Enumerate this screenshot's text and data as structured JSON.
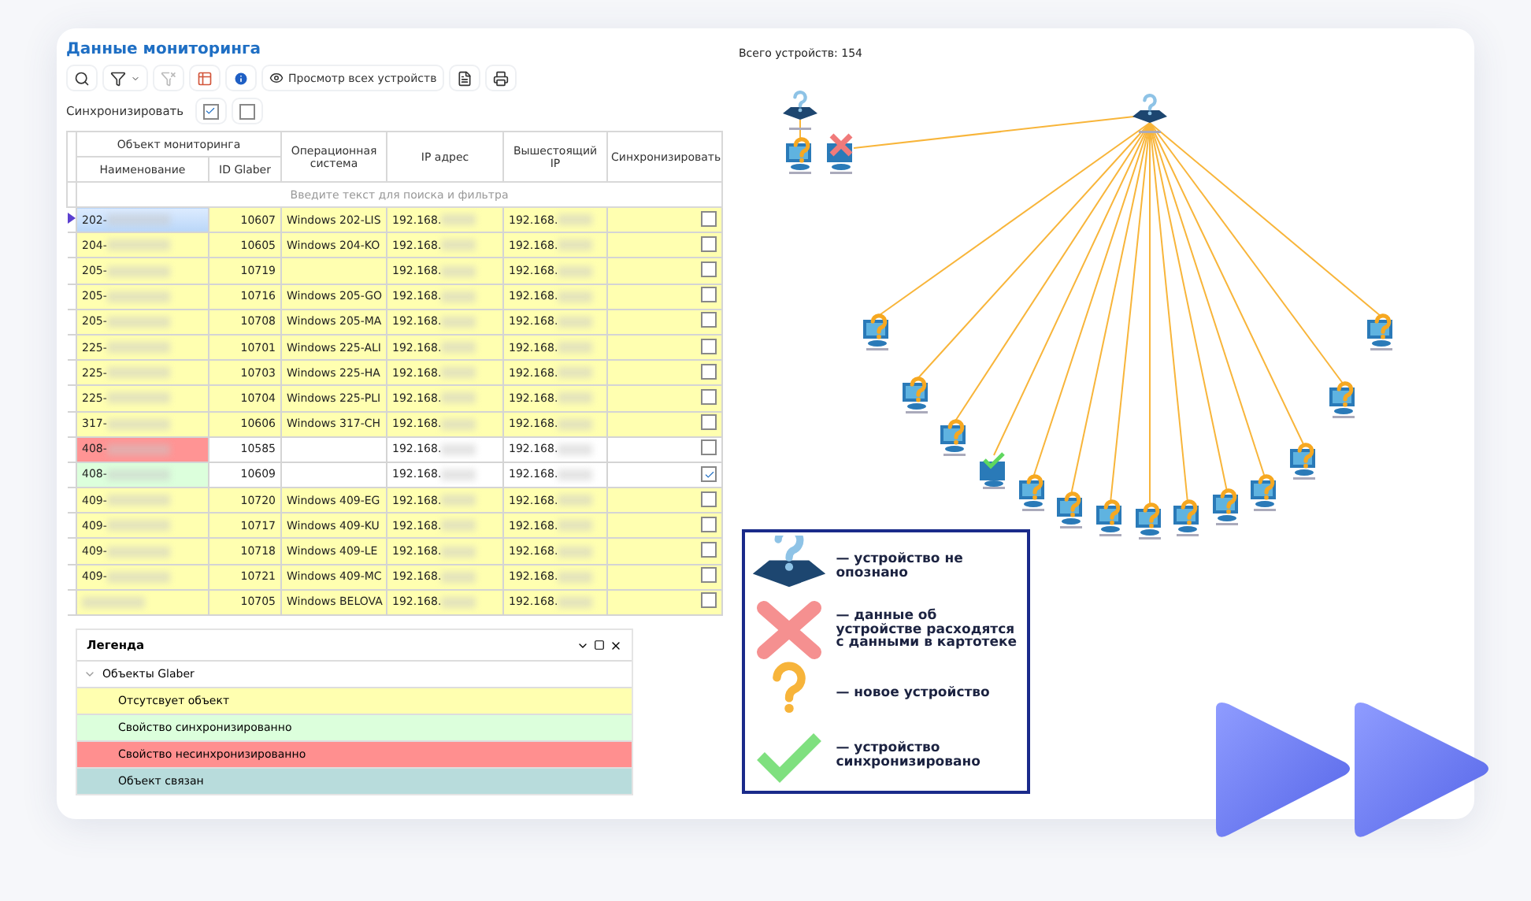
{
  "title": "Данные мониторинга",
  "toolbar": {
    "view_all_button": "Просмотр всех устройств",
    "filter_clear_disabled": true
  },
  "sync_bar": {
    "label": "Синхронизировать",
    "buttons": [
      {
        "checked": true
      },
      {
        "checked": false
      }
    ]
  },
  "table": {
    "group_header": "Объект мониторинга",
    "columns": [
      "Наименование",
      "ID Glaber",
      "Операционная система",
      "IP адрес",
      "Вышестоящий IP",
      "Синхронизировать"
    ],
    "filter_placeholder": "Введите текст для поиска и фильтра",
    "rows": [
      {
        "name": "202-",
        "id": "10607",
        "os": "Windows 202-LIS",
        "ip": "192.168.",
        "parent_ip": "192.168.",
        "checked": false,
        "kind": "missing",
        "selected": true
      },
      {
        "name": "204-",
        "id": "10605",
        "os": "Windows 204-KO",
        "ip": "192.168.",
        "parent_ip": "192.168.",
        "checked": false,
        "kind": "missing",
        "selected": false
      },
      {
        "name": "205-",
        "id": "10719",
        "ip": "192.168.",
        "parent_ip": "192.168.",
        "checked": false,
        "kind": "missing",
        "selected": false
      },
      {
        "name": "205-",
        "id": "10716",
        "os": "Windows 205-GO",
        "ip": "192.168.",
        "parent_ip": "192.168.",
        "checked": false,
        "kind": "missing",
        "selected": false
      },
      {
        "name": "205-",
        "id": "10708",
        "os": "Windows 205-MA",
        "ip": "192.168.",
        "parent_ip": "192.168.",
        "checked": false,
        "kind": "missing",
        "selected": false
      },
      {
        "name": "225-",
        "id": "10701",
        "os": "Windows 225-ALI",
        "ip": "192.168.",
        "parent_ip": "192.168.",
        "checked": false,
        "kind": "missing",
        "selected": false
      },
      {
        "name": "225-",
        "id": "10703",
        "os": "Windows 225-HA",
        "ip": "192.168.",
        "parent_ip": "192.168.",
        "checked": false,
        "kind": "missing",
        "selected": false
      },
      {
        "name": "225-",
        "id": "10704",
        "os": "Windows 225-PLI",
        "ip": "192.168.",
        "parent_ip": "192.168.",
        "checked": false,
        "kind": "missing",
        "selected": false
      },
      {
        "name": "317-",
        "id": "10606",
        "os": "Windows 317-CH",
        "ip": "192.168.",
        "parent_ip": "192.168.",
        "checked": false,
        "kind": "missing",
        "selected": false
      },
      {
        "name": "408-",
        "id": "10585",
        "ip": "192.168.",
        "parent_ip": "192.168.",
        "checked": false,
        "kind": "unsynced",
        "selected": false
      },
      {
        "name": "408-",
        "id": "10609",
        "ip": "192.168.",
        "parent_ip": "192.168.",
        "checked": true,
        "kind": "synced",
        "selected": false
      },
      {
        "name": "409-",
        "id": "10720",
        "os": "Windows 409-EG",
        "ip": "192.168.",
        "parent_ip": "192.168.",
        "checked": false,
        "kind": "missing",
        "selected": false
      },
      {
        "name": "409-",
        "id": "10717",
        "os": "Windows 409-KU",
        "ip": "192.168.",
        "parent_ip": "192.168.",
        "checked": false,
        "kind": "missing",
        "selected": false
      },
      {
        "name": "409-",
        "id": "10718",
        "os": "Windows 409-LE",
        "ip": "192.168.",
        "parent_ip": "192.168.",
        "checked": false,
        "kind": "missing",
        "selected": false
      },
      {
        "name": "409-",
        "id": "10721",
        "os": "Windows 409-MC",
        "ip": "192.168.",
        "parent_ip": "192.168.",
        "checked": false,
        "kind": "missing",
        "selected": false
      },
      {
        "id": "10705",
        "os": "Windows BELOVA",
        "ip": "192.168.",
        "parent_ip": "192.168.",
        "checked": false,
        "kind": "missing",
        "selected": false
      }
    ]
  },
  "legend_panel": {
    "title": "Легенда",
    "root": {
      "label": "Объекты Glaber",
      "expanded": true,
      "children": [
        {
          "label": "Отсутсвует объект",
          "color": "#ffffb0"
        },
        {
          "label": "Свойство синхронизированно",
          "color": "#dcffdc"
        },
        {
          "label": "Свойство несинхронизированно",
          "color": "#ff8f8f"
        },
        {
          "label": "Объект связан",
          "color": "#b8dcdc"
        }
      ]
    }
  },
  "diagram": {
    "total": "Всего устройств: 154",
    "nodes": [
      {
        "kind": "unknown"
      },
      {
        "kind": "new"
      },
      {
        "kind": "mismatch"
      },
      {
        "kind": "unknown"
      },
      {
        "kind": "new"
      },
      {
        "kind": "new"
      },
      {
        "kind": "new"
      },
      {
        "kind": "synced"
      },
      {
        "kind": "new"
      },
      {
        "kind": "new"
      },
      {
        "kind": "new"
      },
      {
        "kind": "new"
      },
      {
        "kind": "new"
      },
      {
        "kind": "new"
      },
      {
        "kind": "new"
      },
      {
        "kind": "new"
      },
      {
        "kind": "new"
      },
      {
        "kind": "new"
      }
    ]
  },
  "key": [
    {
      "kind": "unknown",
      "text": "— устройство не опознано"
    },
    {
      "kind": "mismatch",
      "text": "— данные об устройстве расходятся с данными в картотеке"
    },
    {
      "kind": "new",
      "text": "— новое устройство"
    },
    {
      "kind": "synced",
      "text": "— устройство синхронизировано"
    }
  ]
}
